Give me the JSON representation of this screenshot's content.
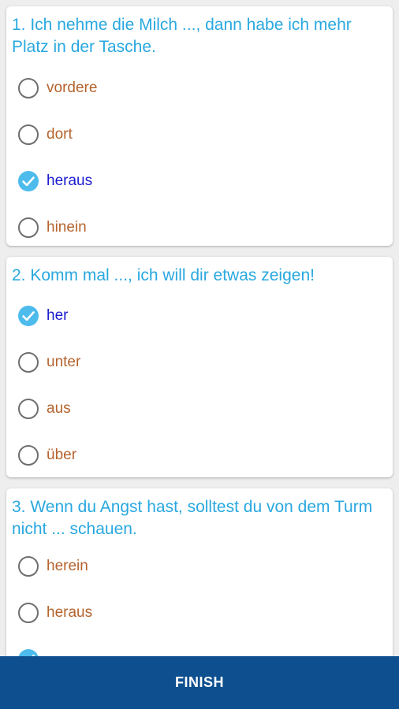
{
  "colors": {
    "question": "#29a8e0",
    "option": "#b5632c",
    "option_selected": "#1a1ad0",
    "check_fill": "#4dbbec",
    "finish_bg": "#0d4f8f"
  },
  "questions": [
    {
      "text": "1. Ich nehme die Milch ..., dann habe ich mehr Platz in der Tasche.",
      "options": [
        "vordere",
        "dort",
        "heraus",
        "hinein"
      ],
      "selected_index": 2
    },
    {
      "text": "2. Komm mal ..., ich will dir etwas zeigen!",
      "options": [
        "her",
        "unter",
        "aus",
        "über"
      ],
      "selected_index": 0
    },
    {
      "text": "3. Wenn du Angst hast, solltest du von dem Turm nicht ... schauen.",
      "options": [
        "herein",
        "heraus"
      ],
      "selected_index": 2
    }
  ],
  "footer": {
    "finish_label": "FINISH"
  }
}
